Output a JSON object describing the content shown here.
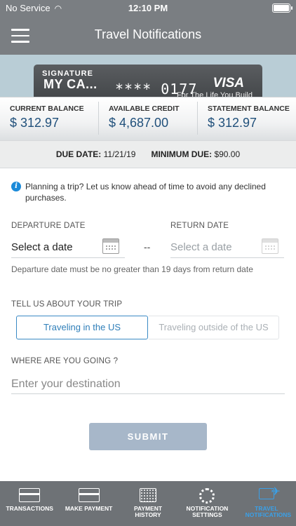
{
  "status_bar": {
    "carrier": "No Service",
    "time": "12:10 PM"
  },
  "header": {
    "title": "Travel Notifications"
  },
  "card": {
    "type_label": "SIGNATURE",
    "name": "MY CA...",
    "masked_number": "**** 0177",
    "brand": "VISA",
    "tagline": "For The Life You Build"
  },
  "balances": [
    {
      "label": "CURRENT BALANCE",
      "value": "$ 312.97"
    },
    {
      "label": "AVAILABLE CREDIT",
      "value": "$ 4,687.00"
    },
    {
      "label": "STATEMENT BALANCE",
      "value": "$ 312.97"
    }
  ],
  "due": {
    "due_label": "DUE DATE:",
    "due_value": "11/21/19",
    "min_label": "MINIMUM DUE:",
    "min_value": "$90.00"
  },
  "info_text": "Planning a trip? Let us know ahead of time to avoid any declined purchases.",
  "departure": {
    "label": "DEPARTURE DATE",
    "value": "Select a date"
  },
  "separator": "--",
  "return": {
    "label": "RETURN DATE",
    "placeholder": "Select a date"
  },
  "date_hint": "Departure date must be no greater than 19 days from return date",
  "trip": {
    "label": "TELL US ABOUT YOUR TRIP",
    "options": [
      "Traveling in the US",
      "Traveling outside of the US"
    ],
    "selected": "Traveling in the US"
  },
  "destination": {
    "label": "WHERE ARE YOU GOING ?",
    "placeholder": "Enter your destination"
  },
  "submit_label": "SUBMIT",
  "tabs": [
    {
      "label": "TRANSACTIONS",
      "icon": "card-icon"
    },
    {
      "label": "MAKE PAYMENT",
      "icon": "card-icon"
    },
    {
      "label": "PAYMENT HISTORY",
      "icon": "calendar-icon"
    },
    {
      "label": "NOTIFICATION SETTINGS",
      "icon": "gear-icon"
    },
    {
      "label": "TRAVEL NOTIFICATIONS",
      "icon": "plane-icon",
      "active": true
    }
  ],
  "colors": {
    "header": "#7a7e82",
    "accent": "#2f7fb9",
    "submit": "#a7b7c9",
    "tab_active": "#3aa0e8"
  }
}
